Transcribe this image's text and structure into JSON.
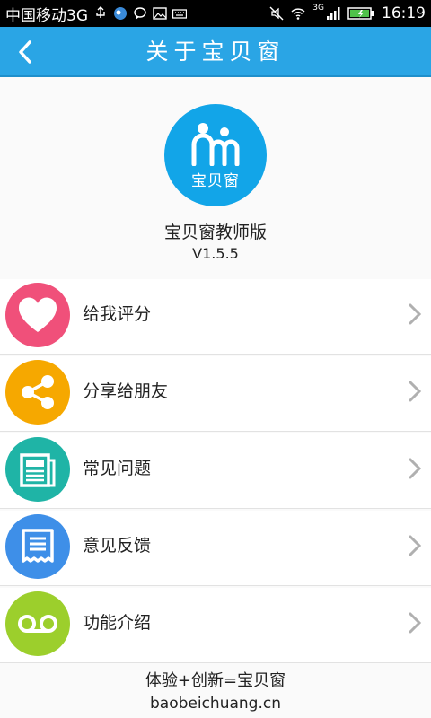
{
  "status_bar": {
    "carrier": "中国移动3G",
    "network_badge": "3G",
    "time": "16:19",
    "icons": [
      "usb-icon",
      "app-notification-icon",
      "message-icon",
      "image-icon",
      "keyboard-icon",
      "mute-icon",
      "wifi-icon",
      "signal-icon",
      "battery-icon"
    ]
  },
  "header": {
    "title": "关于宝贝窗",
    "back_icon": "chevron-left-icon",
    "color": "#2aa5e5"
  },
  "app": {
    "logo_text": "宝贝窗",
    "name": "宝贝窗教师版",
    "version": "V1.5.5",
    "logo_color": "#12a5e8"
  },
  "menu": {
    "items": [
      {
        "label": "给我评分",
        "icon": "heart-icon",
        "color": "#f0507a"
      },
      {
        "label": "分享给朋友",
        "icon": "share-icon",
        "color": "#f6a800"
      },
      {
        "label": "常见问题",
        "icon": "newspaper-icon",
        "color": "#1fb4a6"
      },
      {
        "label": "意见反馈",
        "icon": "receipt-icon",
        "color": "#3e8fe8"
      },
      {
        "label": "功能介绍",
        "icon": "voicemail-icon",
        "color": "#9ccf2c"
      }
    ]
  },
  "footer": {
    "slogan": "体验+创新=宝贝窗",
    "website": "baobeichuang.cn"
  }
}
